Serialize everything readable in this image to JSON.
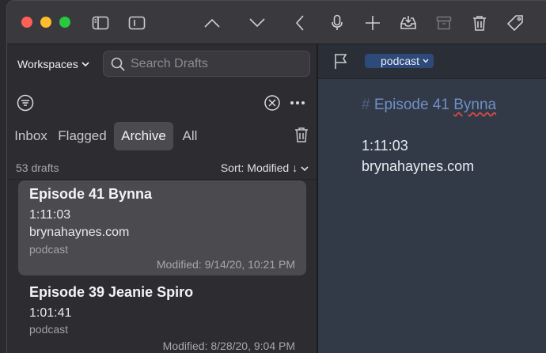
{
  "toolbar": {
    "icons": [
      "sidebar-toggle-icon",
      "panel-toggle-icon",
      "chevron-up-icon",
      "chevron-down-icon",
      "back-icon",
      "microphone-icon",
      "plus-icon",
      "inbox-icon",
      "archive-icon",
      "trash-icon",
      "tag-icon"
    ]
  },
  "sidebar": {
    "workspace_label": "Workspaces",
    "search_placeholder": "Search Drafts",
    "tabs": [
      "Inbox",
      "Flagged",
      "Archive",
      "All"
    ],
    "active_tab": "Archive",
    "count": "53 drafts",
    "sort_label": "Sort: Modified ↓"
  },
  "drafts": [
    {
      "title": "Episode 41 Bynna",
      "lines": [
        "1:11:03",
        "brynahaynes.com"
      ],
      "tag": "podcast",
      "modified": "Modified: 9/14/20, 10:21 PM",
      "selected": true
    },
    {
      "title": "Episode 39 Jeanie Spiro",
      "lines": [
        "1:01:41"
      ],
      "tag": "podcast",
      "modified": "Modified: 8/28/20, 9:04 PM",
      "selected": false
    }
  ],
  "editor": {
    "tag": "podcast",
    "heading_mark": "#",
    "heading_prefix": "Episode 41 ",
    "heading_misspelled": "Bynna",
    "lines": [
      "1:11:03",
      "brynahaynes.com"
    ]
  },
  "colors": {
    "accent": "#2e4a7a",
    "heading": "#6f8fc6",
    "spellcheck": "#d24b4b"
  }
}
